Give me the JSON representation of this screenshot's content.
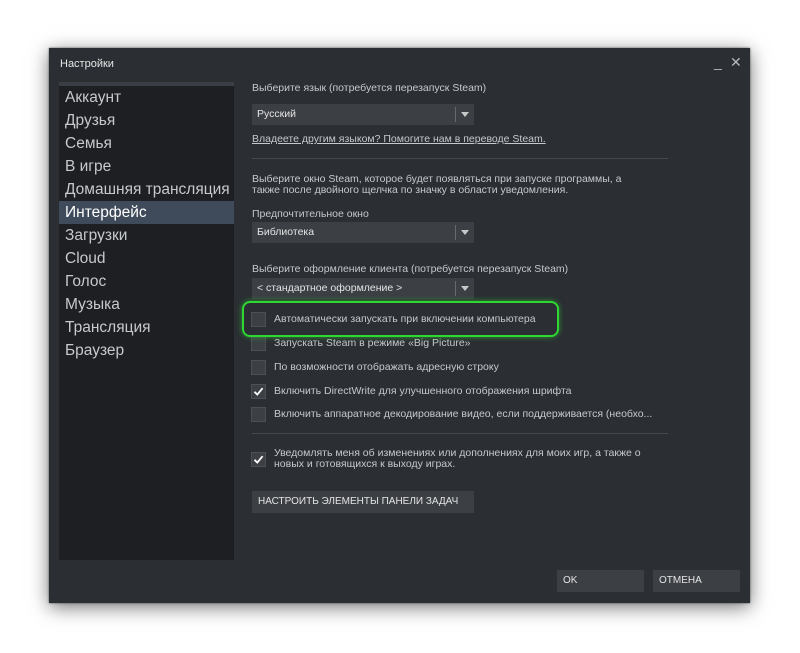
{
  "window": {
    "title": "Настройки",
    "minimize_glyph": "_",
    "close_glyph": "✕"
  },
  "sidebar": {
    "items": [
      {
        "label": "Аккаунт"
      },
      {
        "label": "Друзья"
      },
      {
        "label": "Семья"
      },
      {
        "label": "В игре"
      },
      {
        "label": "Домашняя трансляция"
      },
      {
        "label": "Интерфейс",
        "active": true
      },
      {
        "label": "Загрузки"
      },
      {
        "label": "Cloud"
      },
      {
        "label": "Голос"
      },
      {
        "label": "Музыка"
      },
      {
        "label": "Трансляция"
      },
      {
        "label": "Браузер"
      }
    ]
  },
  "interface": {
    "language_label": "Выберите язык (потребуется перезапуск Steam)",
    "language_value": "Русский",
    "translate_link": "Владеете другим языком? Помогите нам в переводе Steam.",
    "startup_window_desc_line1": "Выберите окно Steam, которое будет появляться при запуске программы, а",
    "startup_window_desc_line2": "также после двойного щелчка по значку в области уведомления.",
    "preferred_window_label": "Предпочтительное окно",
    "preferred_window_value": "Библиотека",
    "skin_label": "Выберите оформление клиента (потребуется перезапуск Steam)",
    "skin_value": "< стандартное оформление >",
    "checkboxes": [
      {
        "label": "Автоматически запускать при включении компьютера",
        "checked": false
      },
      {
        "label": "Запускать Steam в режиме «Big Picture»",
        "checked": false
      },
      {
        "label": "По возможности отображать адресную строку",
        "checked": false
      },
      {
        "label": "Включить DirectWrite для улучшенного отображения шрифта",
        "checked": true
      },
      {
        "label": "Включить аппаратное декодирование видео, если поддерживается (необхо...",
        "checked": false
      }
    ],
    "notify_label": "Уведомлять меня об изменениях или дополнениях для моих игр, а также о новых и готовящихся к выходу играх.",
    "notify_checked": true,
    "taskbar_button": "НАСТРОИТЬ ЭЛЕМЕНТЫ ПАНЕЛИ ЗАДАЧ"
  },
  "footer": {
    "ok": "OK",
    "cancel": "ОТМЕНА"
  },
  "colors": {
    "highlight": "#2fd733",
    "active_item": "#3f4b5a",
    "window_bg": "#2b2e33"
  }
}
